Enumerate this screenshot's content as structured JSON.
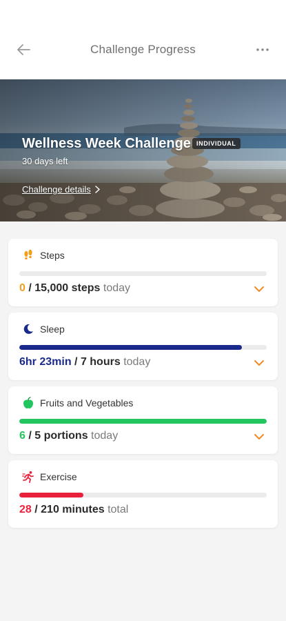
{
  "header": {
    "title": "Challenge Progress"
  },
  "hero": {
    "challenge_name": "Wellness Week Challenge",
    "badge": "INDIVIDUAL",
    "days_left": "30 days left",
    "details_link": "Challenge details"
  },
  "colors": {
    "steps": "#f0a020",
    "sleep": "#1a2a8c",
    "fruits": "#22c55e",
    "exercise": "#e8213a",
    "chevron": "#f08a24"
  },
  "metrics": [
    {
      "name": "Steps",
      "icon": "footprints-icon",
      "current": "0",
      "goal": "/ 15,000 steps",
      "period": "today",
      "progress": 0.0,
      "expandable": true
    },
    {
      "name": "Sleep",
      "icon": "moon-icon",
      "current": "6hr 23min",
      "goal": "/ 7 hours",
      "period": "today",
      "progress": 0.9,
      "expandable": true
    },
    {
      "name": "Fruits and Vegetables",
      "icon": "apple-icon",
      "current": "6",
      "goal": "/ 5 portions",
      "period": "today",
      "progress": 1.0,
      "expandable": true
    },
    {
      "name": "Exercise",
      "icon": "running-icon",
      "current": "28",
      "goal": "/ 210 minutes",
      "period": "total",
      "progress": 0.26,
      "expandable": false
    }
  ]
}
